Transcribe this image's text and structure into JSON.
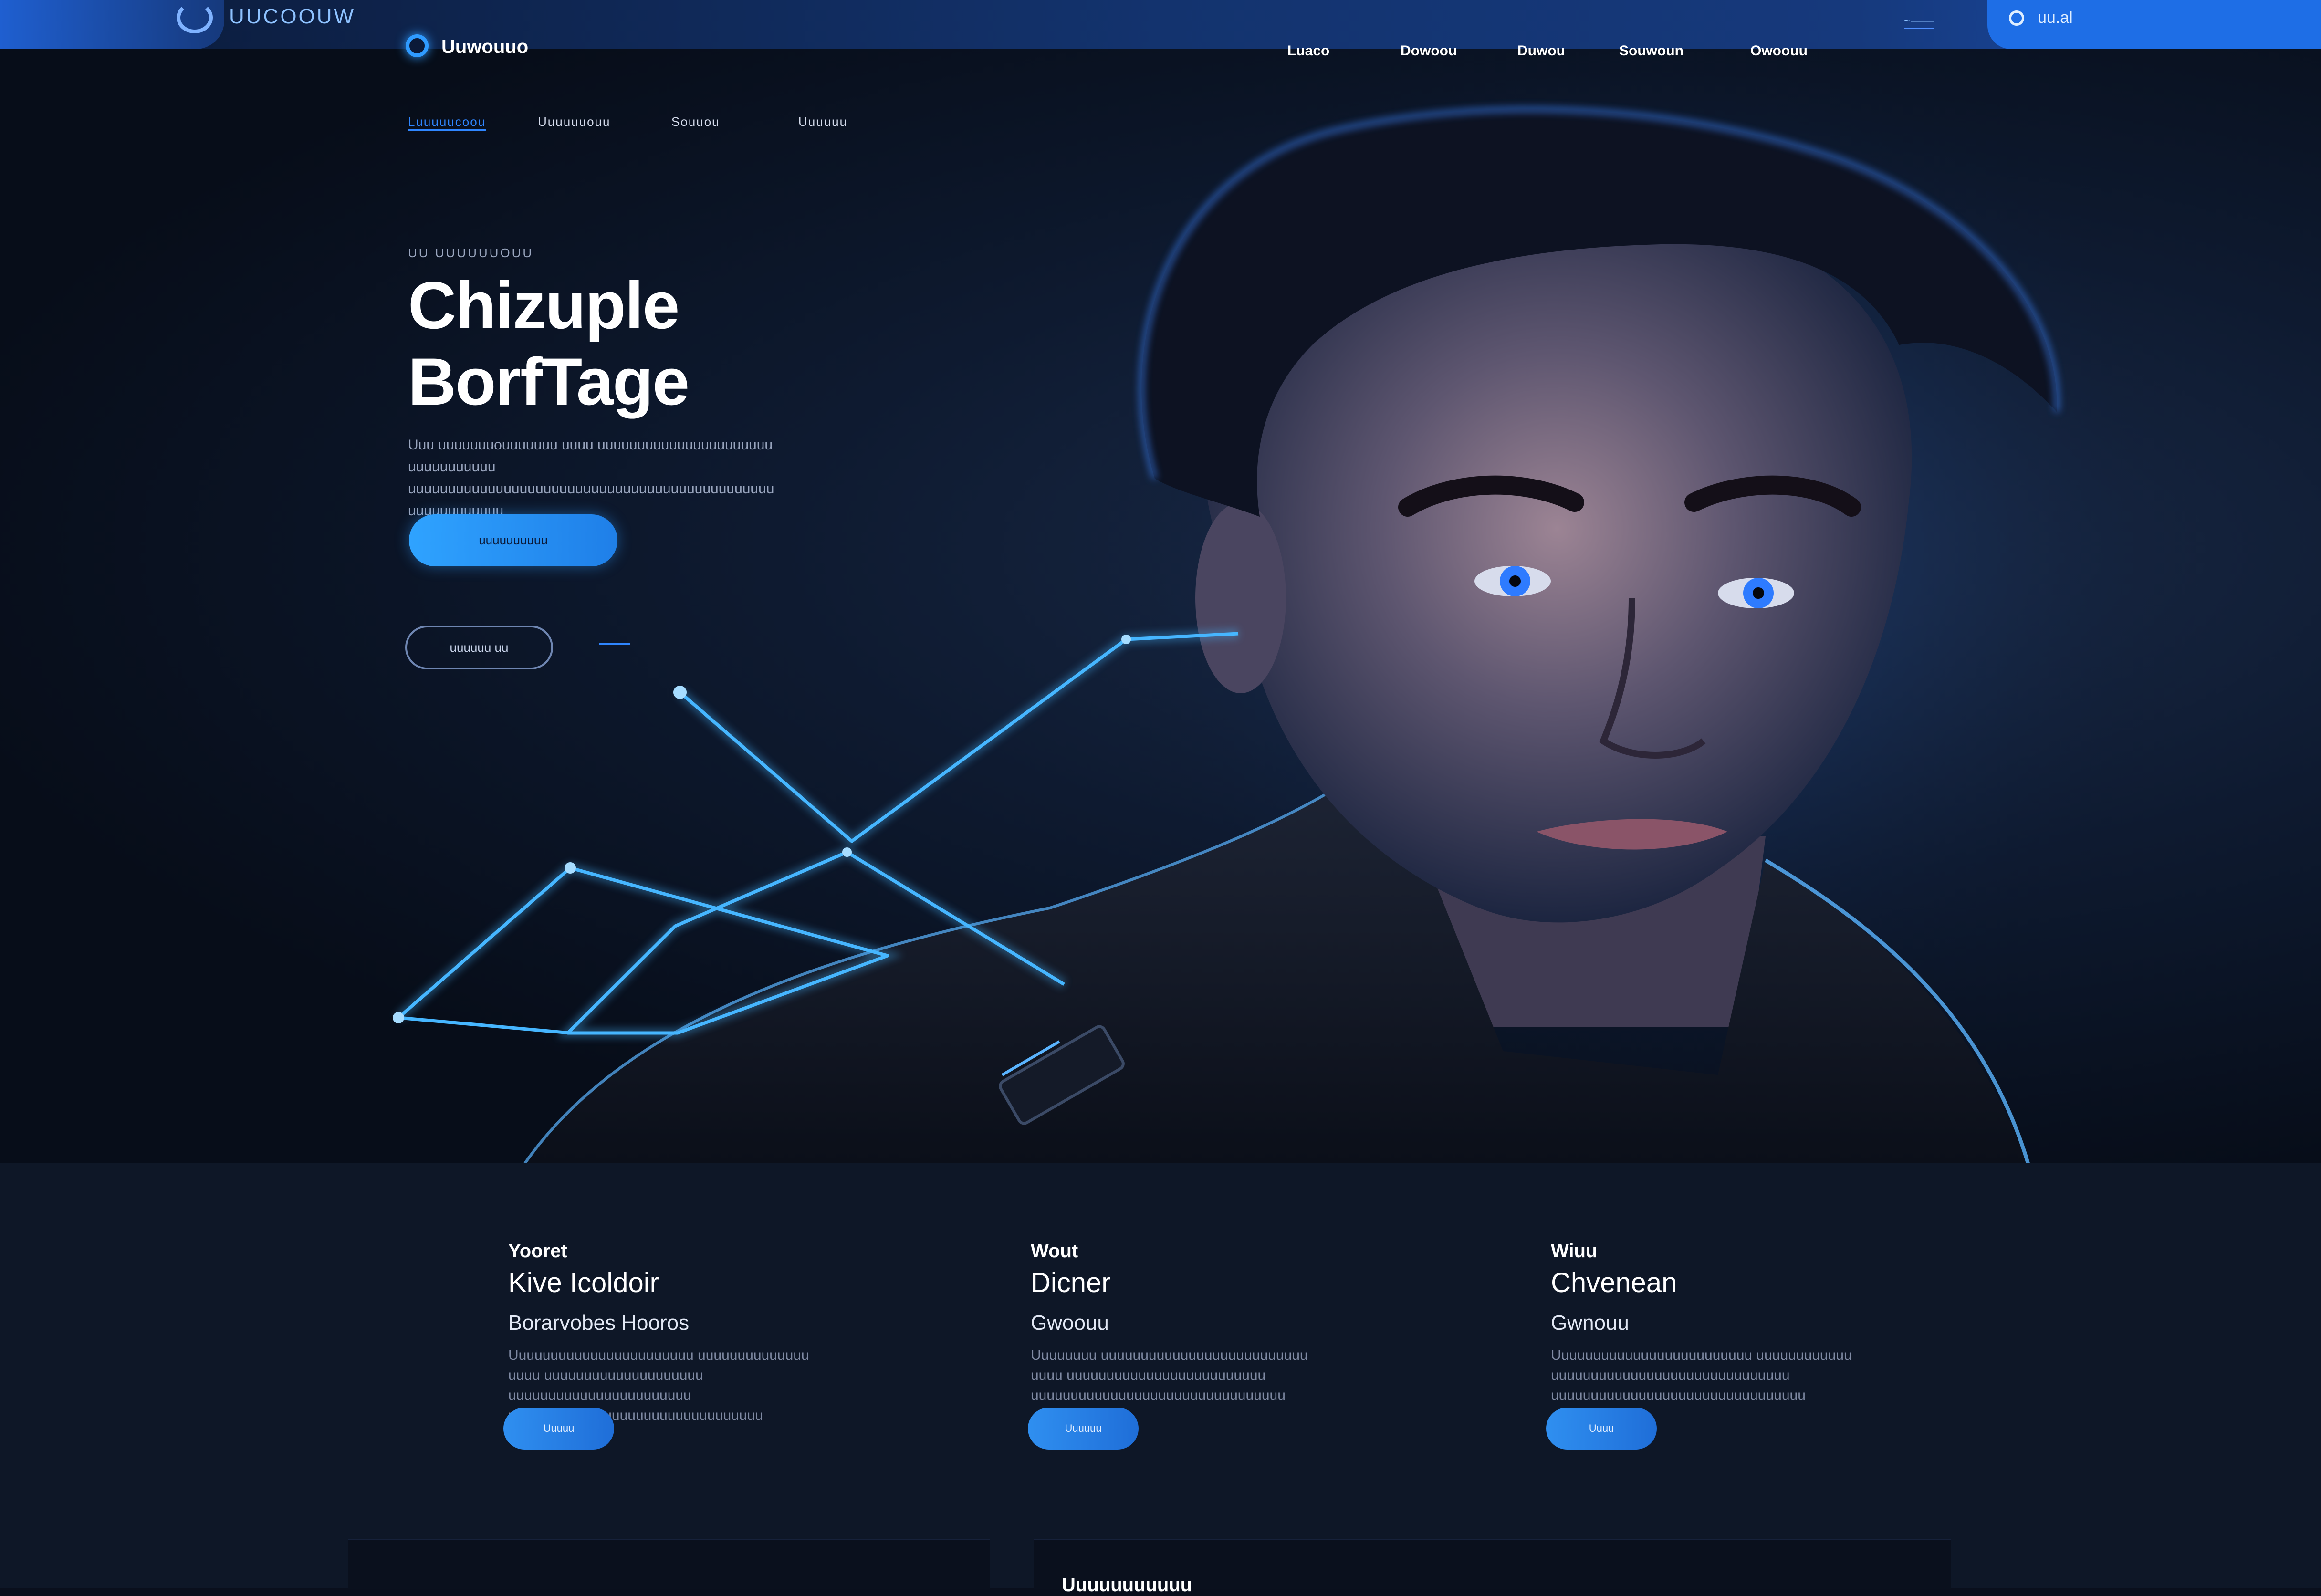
{
  "browser": {
    "title": "UUCOOUW",
    "link": "~——",
    "search_text": "uu.al"
  },
  "brand": {
    "name": "Uuwouuo"
  },
  "nav": [
    "Luaco",
    "Dowoou",
    "Duwou",
    "Souwoun",
    "Owoouu"
  ],
  "subnav": [
    "Luuuuucoou",
    "Uuuuuuouu",
    "Souuou",
    "Uuuuuu"
  ],
  "hero": {
    "kicker": "UU UUUUUUOUU",
    "title_line1": "Chizuple",
    "title_line2": "BorfTage",
    "description": "Uuu uuuuuuuouuuuuuu uuuu uuuuuuuuuuuuuuuuuuuuuu uuuuuuuuuuu uuuuuuuuuuuuuuuuuuuuuuuuuuuuuuuuuuuuuuuuuuuuuu uuuuuuuuuuuu",
    "cta_primary": "uuuuuuuuuu",
    "cta_secondary": "uuuuuu uu"
  },
  "features": [
    {
      "kicker": "Yooret",
      "title": "Kive Icoldoir",
      "subtitle": "Borarvobes Hooros",
      "description": "Uuuuuuuuuuuuuuuuuuuuuuu uuuuuuuuuuuuuu uuuu uuuuuuuuuuuuuuuuuuuu uuuuuuuuuuuuuuuuuuuuuuu uuuuuuuuuuuuuuuuuuuuuuuuuuuuuuuu",
      "button": "Uuuuu"
    },
    {
      "kicker": "Wout",
      "title": "Dicner",
      "subtitle": "Gwoouu",
      "description": "Uuuuuuuu uuuuuuuuuuuuuuuuuuuuuuuuuu uuuu uuuuuuuuuuuuuuuuuuuuuuuuu uuuuuuuuuuuuuuuuuuuuuuuuuuuuuuuu",
      "button": "Uuuuuu"
    },
    {
      "kicker": "Wiuu",
      "title": "Chvenean",
      "subtitle": "Gwnouu",
      "description": "Uuuuuuuuuuuuuuuuuuuuuuuuu uuuuuuuuuuuu uuuuuuuuuuuuuuuuuuuuuuuuuuuuuu uuuuuuuuuuuuuuuuuuuuuuuuuuuuuuuu",
      "button": "Uuuu"
    }
  ],
  "bottom_panel": {
    "label": "Uuuuuuuuuuu"
  },
  "colors": {
    "accent": "#2f9bff",
    "background": "#0a0f1c",
    "panel": "#0e1727"
  },
  "icons": [
    "search-icon",
    "brand-logo-icon"
  ]
}
